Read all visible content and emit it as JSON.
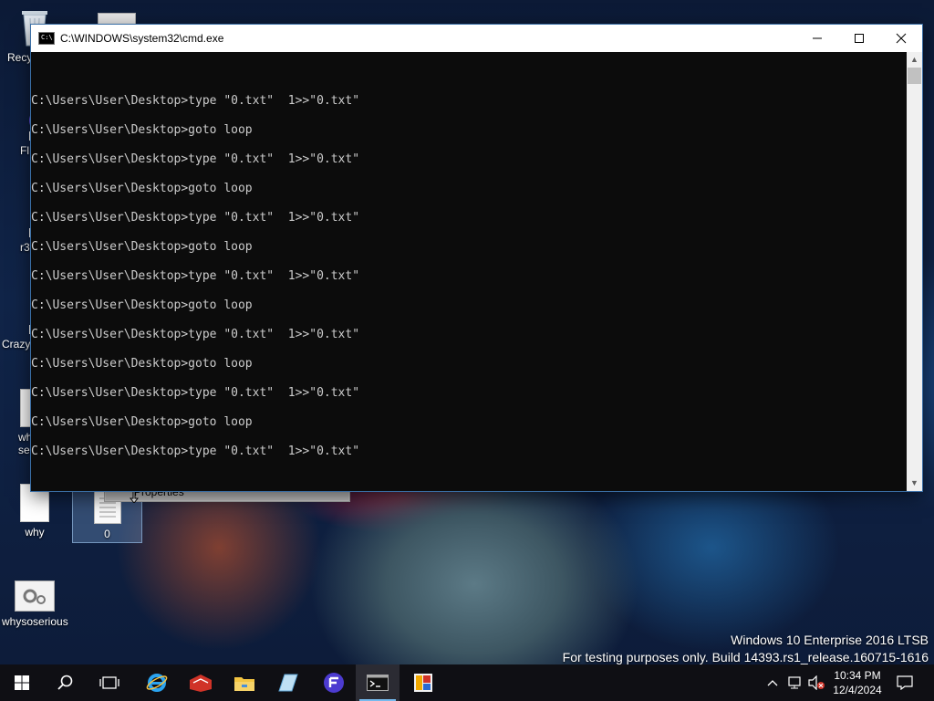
{
  "desktop": {
    "icons": [
      {
        "label": "Recy",
        "icon": "recycle-bin-icon"
      },
      {
        "label": "Fl",
        "icon": "app-shortcut-icon"
      },
      {
        "label": "r3",
        "icon": "app-shortcut-icon"
      },
      {
        "label": "Crazy",
        "icon": "app-shortcut-icon"
      },
      {
        "label": "wh\nser",
        "icon": "document-icon"
      },
      {
        "label": "why",
        "icon": "blank-file-icon"
      },
      {
        "label": "0",
        "icon": "text-file-icon"
      },
      {
        "label": "whysoserious",
        "icon": "settings-file-icon"
      }
    ]
  },
  "context_menu": {
    "item": "Properties"
  },
  "cmd": {
    "title": "C:\\WINDOWS\\system32\\cmd.exe",
    "lines": [
      "C:\\Users\\User\\Desktop>type \"0.txt\"  1>>\"0.txt\"",
      "C:\\Users\\User\\Desktop>goto loop",
      "C:\\Users\\User\\Desktop>type \"0.txt\"  1>>\"0.txt\"",
      "C:\\Users\\User\\Desktop>goto loop",
      "C:\\Users\\User\\Desktop>type \"0.txt\"  1>>\"0.txt\"",
      "C:\\Users\\User\\Desktop>goto loop",
      "C:\\Users\\User\\Desktop>type \"0.txt\"  1>>\"0.txt\"",
      "C:\\Users\\User\\Desktop>goto loop",
      "C:\\Users\\User\\Desktop>type \"0.txt\"  1>>\"0.txt\"",
      "C:\\Users\\User\\Desktop>goto loop",
      "C:\\Users\\User\\Desktop>type \"0.txt\"  1>>\"0.txt\"",
      "C:\\Users\\User\\Desktop>goto loop",
      "C:\\Users\\User\\Desktop>type \"0.txt\"  1>>\"0.txt\""
    ]
  },
  "watermark": {
    "line1": "Windows 10 Enterprise 2016 LTSB",
    "line2": "For testing purposes only. Build 14393.rs1_release.160715-1616"
  },
  "taskbar": {
    "apps": [
      "start-icon",
      "search-icon",
      "task-view-icon",
      "internet-explorer-icon",
      "red-app-icon",
      "file-explorer-icon",
      "blue-app-icon",
      "purple-app-icon",
      "command-prompt-icon",
      "colorful-app-icon"
    ],
    "clock_time": "10:34 PM",
    "clock_date": "12/4/2024"
  },
  "colors": {
    "console_bg": "#0c0c0c",
    "console_text": "#cccccc",
    "taskbar_bg": "#0f0f14"
  }
}
